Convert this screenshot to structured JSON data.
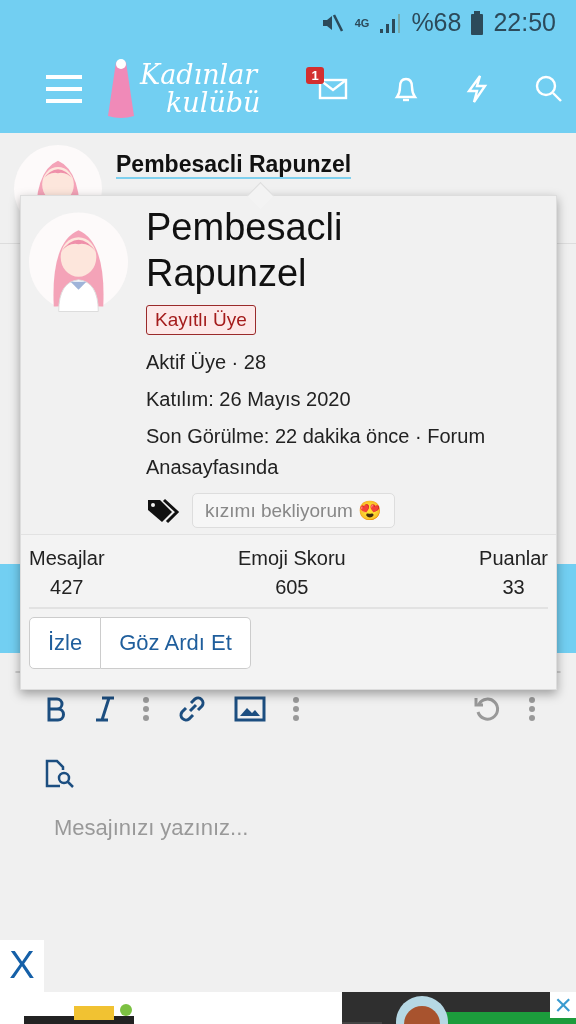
{
  "status_bar": {
    "network": "4G",
    "battery": "%68",
    "time": "22:50"
  },
  "header": {
    "logo_line_1": "Kadınlar",
    "logo_line_2": "kulübü",
    "inbox_badge": "1"
  },
  "member_row": {
    "name": "Pembesacli Rapunzel"
  },
  "popup": {
    "name": "Pembesacli Rapunzel",
    "badge": "Kayıtlı Üye",
    "rank": "Aktif Üye · 28",
    "joined": "Katılım: 26 Mayıs 2020",
    "last_seen": "Son Görülme: 22 dakika önce · Forum Anasayfasında",
    "status_tag": "kızımı bekliyorum 😍",
    "stats": [
      {
        "label": "Mesajlar",
        "value": "427"
      },
      {
        "label": "Emoji Skoru",
        "value": "605"
      },
      {
        "label": "Puanlar",
        "value": "33"
      }
    ],
    "buttons": [
      "İzle",
      "Göz Ardı Et"
    ]
  },
  "editor": {
    "placeholder": "Mesajınızı yazınız..."
  },
  "ad": {
    "close_left": "X",
    "close_right": "×"
  }
}
